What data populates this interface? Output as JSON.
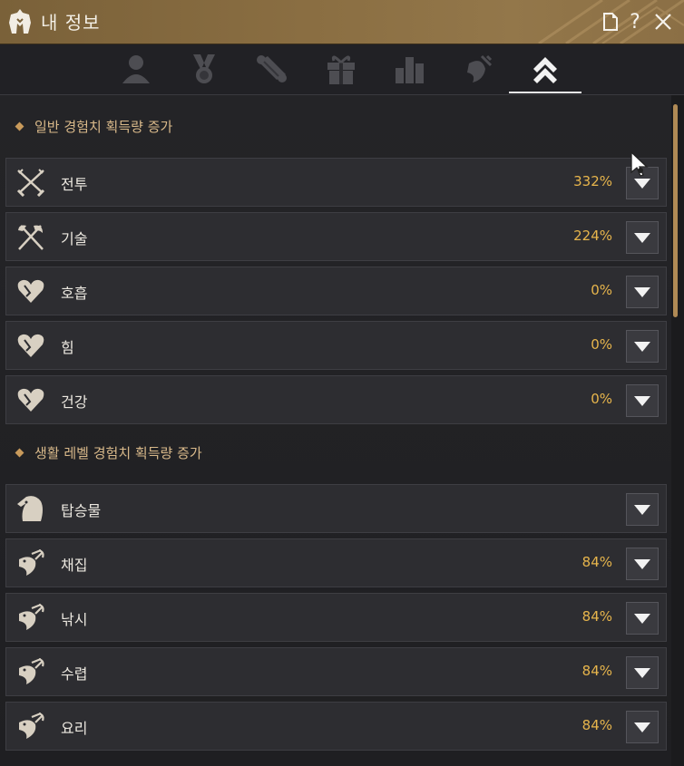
{
  "window": {
    "title": "내 정보"
  },
  "titlebar_buttons": {
    "doc_icon": "document-icon",
    "help_label": "?",
    "close_icon": "close-icon"
  },
  "tabs": [
    {
      "icon": "person-icon",
      "active": false
    },
    {
      "icon": "medal-icon",
      "active": false
    },
    {
      "icon": "scroll-icon",
      "active": false
    },
    {
      "icon": "gift-icon",
      "active": false
    },
    {
      "icon": "bar-chart-icon",
      "active": false
    },
    {
      "icon": "fish-icon",
      "active": false
    },
    {
      "icon": "chevron-up-double-icon",
      "active": true
    }
  ],
  "sections": [
    {
      "title": "일반 경험치 획득량 증가",
      "rows": [
        {
          "icon": "crossed-swords-icon",
          "label": "전투",
          "value": "332%"
        },
        {
          "icon": "axe-icon",
          "label": "기술",
          "value": "224%"
        },
        {
          "icon": "heart-icon",
          "label": "호흡",
          "value": "0%"
        },
        {
          "icon": "heart-icon",
          "label": "힘",
          "value": "0%"
        },
        {
          "icon": "heart-icon",
          "label": "건강",
          "value": "0%"
        }
      ]
    },
    {
      "title": "생활 레벨 경험치 획득량 증가",
      "rows": [
        {
          "icon": "horse-icon",
          "label": "탑승물",
          "value": ""
        },
        {
          "icon": "fish-pickaxe-icon",
          "label": "채집",
          "value": "84%"
        },
        {
          "icon": "fish-pickaxe-icon",
          "label": "낚시",
          "value": "84%"
        },
        {
          "icon": "fish-pickaxe-icon",
          "label": "수렵",
          "value": "84%"
        },
        {
          "icon": "fish-pickaxe-icon",
          "label": "요리",
          "value": "84%"
        }
      ]
    }
  ],
  "colors": {
    "accent": "#e7b54c",
    "section": "#d9b98a",
    "titlebar": "#8a6e42"
  }
}
